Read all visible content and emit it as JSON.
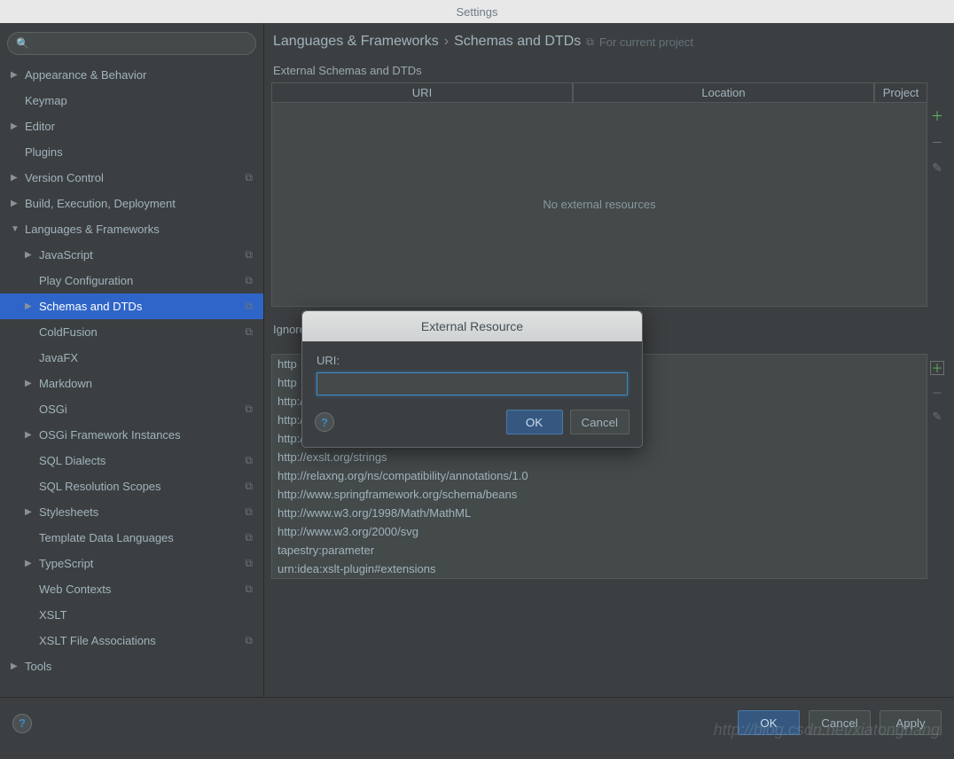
{
  "window": {
    "title": "Settings"
  },
  "search": {
    "placeholder": ""
  },
  "tree": [
    {
      "label": "Appearance & Behavior",
      "depth": 0,
      "arrow": "right",
      "proj": false
    },
    {
      "label": "Keymap",
      "depth": 0,
      "arrow": "none",
      "proj": false
    },
    {
      "label": "Editor",
      "depth": 0,
      "arrow": "right",
      "proj": false
    },
    {
      "label": "Plugins",
      "depth": 0,
      "arrow": "none",
      "proj": false
    },
    {
      "label": "Version Control",
      "depth": 0,
      "arrow": "right",
      "proj": true
    },
    {
      "label": "Build, Execution, Deployment",
      "depth": 0,
      "arrow": "right",
      "proj": false
    },
    {
      "label": "Languages & Frameworks",
      "depth": 0,
      "arrow": "down",
      "proj": false
    },
    {
      "label": "JavaScript",
      "depth": 1,
      "arrow": "right",
      "proj": true
    },
    {
      "label": "Play Configuration",
      "depth": 1,
      "arrow": "none",
      "proj": true
    },
    {
      "label": "Schemas and DTDs",
      "depth": 1,
      "arrow": "right",
      "proj": true,
      "selected": true
    },
    {
      "label": "ColdFusion",
      "depth": 1,
      "arrow": "none",
      "proj": true
    },
    {
      "label": "JavaFX",
      "depth": 1,
      "arrow": "none",
      "proj": false
    },
    {
      "label": "Markdown",
      "depth": 1,
      "arrow": "right",
      "proj": false
    },
    {
      "label": "OSGi",
      "depth": 1,
      "arrow": "none",
      "proj": true
    },
    {
      "label": "OSGi Framework Instances",
      "depth": 1,
      "arrow": "right",
      "proj": false
    },
    {
      "label": "SQL Dialects",
      "depth": 1,
      "arrow": "none",
      "proj": true
    },
    {
      "label": "SQL Resolution Scopes",
      "depth": 1,
      "arrow": "none",
      "proj": true
    },
    {
      "label": "Stylesheets",
      "depth": 1,
      "arrow": "right",
      "proj": true
    },
    {
      "label": "Template Data Languages",
      "depth": 1,
      "arrow": "none",
      "proj": true
    },
    {
      "label": "TypeScript",
      "depth": 1,
      "arrow": "right",
      "proj": true
    },
    {
      "label": "Web Contexts",
      "depth": 1,
      "arrow": "none",
      "proj": true
    },
    {
      "label": "XSLT",
      "depth": 1,
      "arrow": "none",
      "proj": false
    },
    {
      "label": "XSLT File Associations",
      "depth": 1,
      "arrow": "none",
      "proj": true
    },
    {
      "label": "Tools",
      "depth": 0,
      "arrow": "right",
      "proj": false
    }
  ],
  "breadcrumb": {
    "a": "Languages & Frameworks",
    "b": "Schemas and DTDs",
    "note": "For current project"
  },
  "panel1": {
    "label": "External Schemas and DTDs",
    "columns": {
      "uri": "URI",
      "location": "Location",
      "project": "Project"
    },
    "empty": "No external resources"
  },
  "panel2": {
    "label": "Ignored Schemas and DTDs",
    "items": [
      "http",
      "http",
      "http://exslt.org/dynamic",
      "http://exslt.org/math",
      "http://exslt.org/sets",
      "http://exslt.org/strings",
      "http://relaxng.org/ns/compatibility/annotations/1.0",
      "http://www.springframework.org/schema/beans",
      "http://www.w3.org/1998/Math/MathML",
      "http://www.w3.org/2000/svg",
      "tapestry:parameter",
      "urn:idea:xslt-plugin#extensions"
    ]
  },
  "footer": {
    "ok": "OK",
    "cancel": "Cancel",
    "apply": "Apply"
  },
  "dialog": {
    "title": "External Resource",
    "uri_label": "URI:",
    "uri_value": "",
    "ok": "OK",
    "cancel": "Cancel"
  },
  "watermark": "http://blog.csdn.net/xiatonghang"
}
